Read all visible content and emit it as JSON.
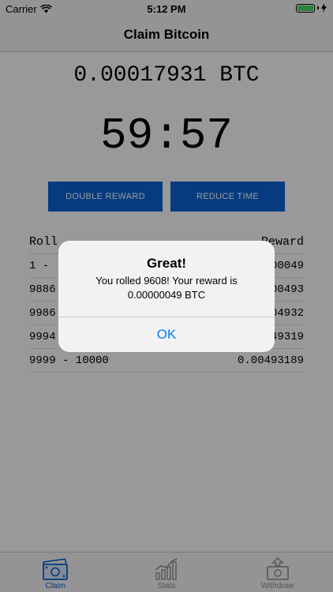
{
  "status_bar": {
    "carrier": "Carrier",
    "time": "5:12 PM"
  },
  "nav": {
    "title": "Claim Bitcoin"
  },
  "balance": "0.00017931 BTC",
  "timer": "59:57",
  "buttons": {
    "double_reward": "DOUBLE REWARD",
    "reduce_time": "REDUCE TIME"
  },
  "table": {
    "headers": {
      "roll": "Roll",
      "reward": "Reward"
    },
    "rows": [
      {
        "roll": "1 -",
        "reward": "0.00000049"
      },
      {
        "roll": "9886",
        "reward": "0.00000493"
      },
      {
        "roll": "9986",
        "reward": "0.00004932"
      },
      {
        "roll": "9994",
        "reward": "0.00049319"
      },
      {
        "roll": "9999 - 10000",
        "reward": "0.00493189"
      }
    ]
  },
  "tabs": [
    {
      "label": "Claim",
      "icon": "money-icon",
      "active": true
    },
    {
      "label": "Stats",
      "icon": "chart-icon",
      "active": false
    },
    {
      "label": "Withdraw",
      "icon": "withdraw-icon",
      "active": false
    }
  ],
  "alert": {
    "title": "Great!",
    "message": "You rolled 9608! Your reward is 0.00000049 BTC",
    "button": "OK"
  },
  "colors": {
    "accent": "#0a63d6",
    "alert_button": "#007aff",
    "battery": "#4cd964"
  }
}
